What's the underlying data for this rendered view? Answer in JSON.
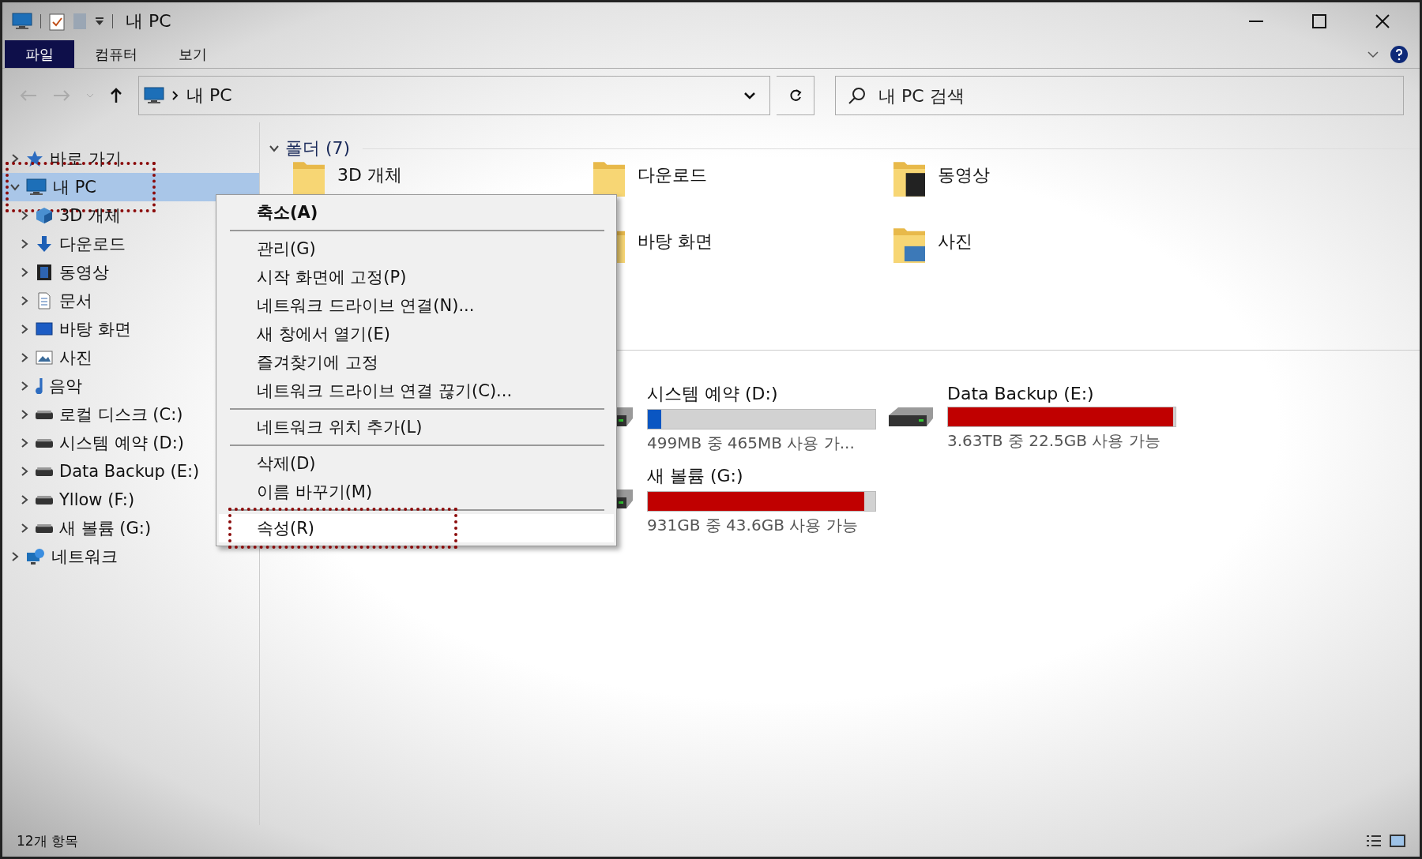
{
  "window": {
    "title": "내 PC"
  },
  "ribbon_tabs": [
    {
      "label": "파일",
      "kind": "file-menu"
    },
    {
      "label": "컴퓨터",
      "kind": "tab"
    },
    {
      "label": "보기",
      "kind": "tab"
    }
  ],
  "address_bar": {
    "path": "내 PC"
  },
  "search": {
    "placeholder": "내 PC 검색"
  },
  "navigation": [
    {
      "label": "바로 가기",
      "expanded": false,
      "selected": false,
      "annotated": false
    },
    {
      "label": "내 PC",
      "expanded": true,
      "selected": true,
      "annotated": true,
      "children": [
        {
          "label": "3D 개체"
        },
        {
          "label": "다운로드"
        },
        {
          "label": "동영상"
        },
        {
          "label": "문서"
        },
        {
          "label": "바탕 화면"
        },
        {
          "label": "사진"
        },
        {
          "label": "음악"
        },
        {
          "label": "로컬 디스크 (C:)"
        },
        {
          "label": "시스템 예약 (D:)"
        },
        {
          "label": "Data Backup (E:)"
        },
        {
          "label": "Yllow (F:)"
        },
        {
          "label": "새 볼륨 (G:)"
        }
      ]
    },
    {
      "label": "네트워크",
      "expanded": false,
      "selected": false,
      "annotated": false
    }
  ],
  "folders_section": {
    "title": "폴더 (7)",
    "expanded": true
  },
  "folders": [
    {
      "name": "3D 개체"
    },
    {
      "name": "다운로드"
    },
    {
      "name": "동영상"
    },
    {
      "name": "바탕 화면"
    },
    {
      "name": "사진"
    }
  ],
  "drives": [
    {
      "name": "시스템 예약 (D:)",
      "level": 0.06,
      "color": "#0a56c2",
      "free": "499MB 중 465MB 사용 가..."
    },
    {
      "name": "Data Backup (E:)",
      "level": 0.99,
      "color": "#c00000",
      "free": "3.63TB 중 22.5GB 사용 가능"
    },
    {
      "name": "새 볼륨 (G:)",
      "level": 0.95,
      "color": "#c00000",
      "free": "931GB 중 43.6GB 사용 가능"
    }
  ],
  "context_menu": {
    "groups": [
      [
        {
          "label": "축소(A)",
          "bold": true,
          "selected": false,
          "annotated": false
        }
      ],
      [
        {
          "label": "관리(G)",
          "bold": false,
          "selected": false,
          "annotated": false
        },
        {
          "label": "시작 화면에 고정(P)",
          "bold": false,
          "selected": false,
          "annotated": false
        },
        {
          "label": "네트워크 드라이브 연결(N)...",
          "bold": false,
          "selected": false,
          "annotated": false
        },
        {
          "label": "새 창에서 열기(E)",
          "bold": false,
          "selected": false,
          "annotated": false
        },
        {
          "label": "즐겨찾기에 고정",
          "bold": false,
          "selected": false,
          "annotated": false
        },
        {
          "label": "네트워크 드라이브 연결 끊기(C)...",
          "bold": false,
          "selected": false,
          "annotated": false
        }
      ],
      [
        {
          "label": "네트워크 위치 추가(L)",
          "bold": false,
          "selected": false,
          "annotated": false
        }
      ],
      [
        {
          "label": "삭제(D)",
          "bold": false,
          "selected": false,
          "annotated": false
        },
        {
          "label": "이름 바꾸기(M)",
          "bold": false,
          "selected": false,
          "annotated": false
        }
      ],
      [
        {
          "label": "속성(R)",
          "bold": false,
          "selected": true,
          "annotated": true
        }
      ]
    ]
  },
  "status_bar": {
    "count": "12개 항목"
  }
}
